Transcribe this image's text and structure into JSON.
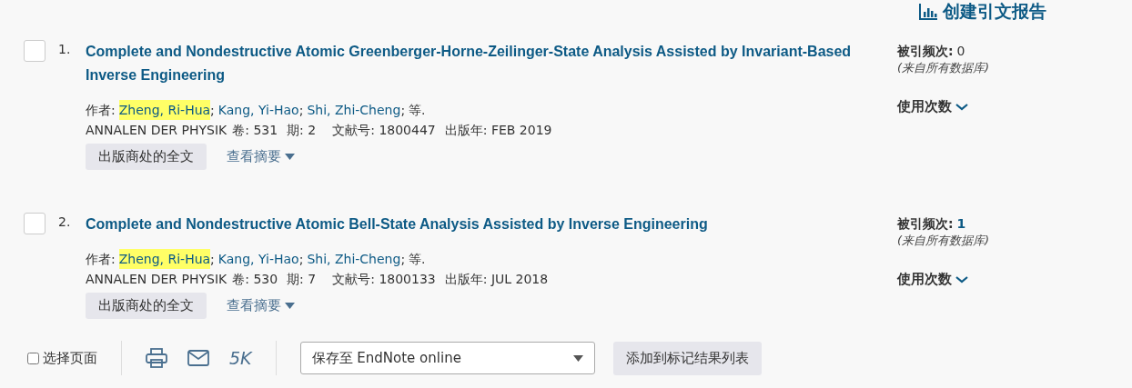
{
  "report_link": {
    "label": "创建引文报告"
  },
  "records": [
    {
      "number": "1.",
      "checked": false,
      "title": "Complete and Nondestructive Atomic Greenberger-Horne-Zeilinger-State Analysis Assisted by Invariant-Based Inverse Engineering",
      "authors_label": "作者:",
      "authors": [
        {
          "name": "Zheng, Ri-Hua",
          "highlighted": true,
          "separator": ";"
        },
        {
          "name": "Kang, Yi-Hao",
          "highlighted": false,
          "separator": ";"
        },
        {
          "name": "Shi, Zhi-Cheng",
          "highlighted": false,
          "separator": ";"
        }
      ],
      "et_al": "等.",
      "journal": "ANNALEN DER PHYSIK",
      "meta": [
        {
          "label": "卷:",
          "value": "531"
        },
        {
          "label": "期:",
          "value": "2"
        },
        {
          "label": "文献号:",
          "value": "1800447"
        },
        {
          "label": "出版年:",
          "value": "FEB 2019"
        }
      ],
      "fulltext_button": "出版商处的全文",
      "abstract_link": "查看摘要",
      "cited_label": "被引频次:",
      "cited_count": "0",
      "cited_linked": false,
      "cited_note": "(来自所有数据库)",
      "usage_label": "使用次数"
    },
    {
      "number": "2.",
      "checked": false,
      "title": "Complete and Nondestructive Atomic Bell-State Analysis Assisted by Inverse Engineering",
      "authors_label": "作者:",
      "authors": [
        {
          "name": "Zheng, Ri-Hua",
          "highlighted": true,
          "separator": ";"
        },
        {
          "name": "Kang, Yi-Hao",
          "highlighted": false,
          "separator": ";"
        },
        {
          "name": "Shi, Zhi-Cheng",
          "highlighted": false,
          "separator": ";"
        }
      ],
      "et_al": "等.",
      "journal": "ANNALEN DER PHYSIK",
      "meta": [
        {
          "label": "卷:",
          "value": "530"
        },
        {
          "label": "期:",
          "value": "7"
        },
        {
          "label": "文献号:",
          "value": "1800133"
        },
        {
          "label": "出版年:",
          "value": "JUL 2018"
        }
      ],
      "fulltext_button": "出版商处的全文",
      "abstract_link": "查看摘要",
      "cited_label": "被引频次:",
      "cited_count": "1",
      "cited_linked": true,
      "cited_note": "(来自所有数据库)",
      "usage_label": "使用次数"
    }
  ],
  "toolbar": {
    "select_page": {
      "label": "选择页面",
      "checked": false
    },
    "count": "5K",
    "save_select": {
      "value": "保存至 EndNote online"
    },
    "add_button": "添加到标记结果列表"
  }
}
